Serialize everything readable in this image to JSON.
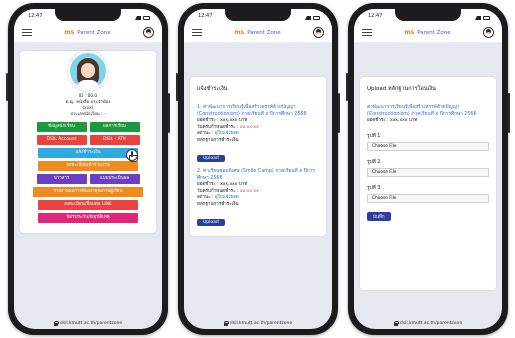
{
  "status": {
    "time": "12:47"
  },
  "app": {
    "brand_logo": "ms",
    "brand_title": "Parent Zone",
    "url": "dsil.kmutt.ac.th/parentzone"
  },
  "phone1": {
    "profile": {
      "id": "ID : 00.0",
      "name": "ด.ญ. หนังสือ ประจำห้อง",
      "class": "(xxx)",
      "detail": "ประเภทนักเรียน : -"
    },
    "buttons": {
      "student_info": "ข้อมูลนักเรียน",
      "timetable": "ผลการเรียน",
      "dsil_account": "DSIL Account",
      "dsil_atk": "DSIL - ATK",
      "payment": "แจ้งชำระเงิน",
      "register_events": "ลงทะเบียนเข้าร่วมงาน",
      "news": "ข่าวสาร",
      "evaluation": "แบบประเมินผล",
      "quality_report": "รายงานผลการพัฒนาคุณภาพผู้เรียน",
      "line_register": "ลงทะเบียนเชื่อมต่อ LINE",
      "insurance_card": "บัตรประกันภัยอุบัติเหตุ"
    },
    "colors": {
      "green": "#1a9a3d",
      "red": "#e8433f",
      "sky": "#2fa7e0",
      "orange": "#f08a1c",
      "purple": "#6a3fc4",
      "magenta": "#e1257a"
    }
  },
  "phone2": {
    "section_title": "แจ้งชำระเงิน",
    "items": [
      {
        "title": "1. ค่าพัฒนาการเรียนรู้เพื่อสร้างสรรค์ด้วยปัญญา (Constructionism) ภาคเรียนที่ x ปีการศึกษา 2566",
        "amount_label": "ยอดชำระ : ",
        "amount_value": "xxx,xxx บาท",
        "due_label": "วันครบกำหนดชำระ : ",
        "due_value": "xx xx xx",
        "status_label": "สถานะ : ",
        "status_value": "ดูใบแจ้งยอด",
        "proof_label": "หลักฐานการชำระเงิน",
        "upload_label": "Upload"
      },
      {
        "title": "2. ค่าเรียนซ่อมพิเศษ (Smile Camp) ภาคเรียนที่ x ปีการศึกษา 2566",
        "amount_label": "ยอดชำระ : ",
        "amount_value": "xxx,xxx บาท",
        "due_label": "วันครบกำหนดชำระ : ",
        "due_value": "xx xx xx",
        "status_label": "สถานะ : ",
        "status_value": "ดูใบแจ้งยอด",
        "proof_label": "หลักฐานการชำระเงิน",
        "upload_label": "Upload"
      }
    ]
  },
  "phone3": {
    "title": "Upload หลักฐานการโอนเงิน",
    "item_title": "ค่าพัฒนาการเรียนรู้เพื่อสร้างสรรค์ด้วยปัญญา (Constructionism) ภาคเรียนที่ x ปีการศึกษา 2566",
    "amount_line": "ยอดชำระ : xxx,xxx บาท",
    "rounds": [
      {
        "label": "รูปที่ 1",
        "file_button": "Choose File"
      },
      {
        "label": "รูปที่ 2",
        "file_button": "Choose File"
      },
      {
        "label": "รูปที่ 3",
        "file_button": "Choose File"
      }
    ],
    "save_label": "บันทึก"
  }
}
